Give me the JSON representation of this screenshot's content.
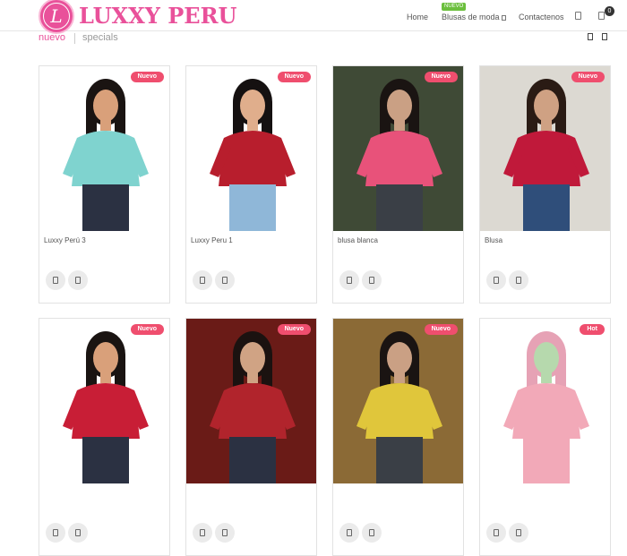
{
  "header": {
    "brand_letter": "L",
    "brand_name": "LUXXY PERU",
    "nav": {
      "home": "Home",
      "blusas": "Blusas de moda",
      "blusas_badge": "NUEVO",
      "contact": "Contactenos"
    },
    "cart_count": "0"
  },
  "tabs": {
    "active": "nuevo",
    "inactive": "specials"
  },
  "products": [
    {
      "name": "Luxxy Perú 3",
      "badge": "Nuevo",
      "bg": "#ffffff",
      "top": "#7fd3cf",
      "skin": "#d9a07a",
      "hair": "#1a1412",
      "bottom": "#2b3142"
    },
    {
      "name": "Luxxy Peru 1",
      "badge": "Nuevo",
      "bg": "#ffffff",
      "top": "#b81e2d",
      "skin": "#e0ae8c",
      "hair": "#151111",
      "bottom": "#8fb7d8"
    },
    {
      "name": "blusa blanca",
      "badge": "Nuevo",
      "bg": "#3f4a36",
      "top": "#e8527a",
      "skin": "#caa084",
      "hair": "#1a1412",
      "bottom": "#3a3f46"
    },
    {
      "name": "Blusa",
      "badge": "Nuevo",
      "bg": "#dcd9d2",
      "top": "#c0193a",
      "skin": "#cfa183",
      "hair": "#2a1b14",
      "bottom": "#2f4e7a"
    },
    {
      "name": "",
      "badge": "Nuevo",
      "bg": "#ffffff",
      "top": "#c81e36",
      "skin": "#d9a07a",
      "hair": "#1a1412",
      "bottom": "#2b3142"
    },
    {
      "name": "",
      "badge": "Nuevo",
      "bg": "#6a1b17",
      "top": "#b1242c",
      "skin": "#d0a384",
      "hair": "#1b1210",
      "bottom": "#2b3142"
    },
    {
      "name": "",
      "badge": "Nuevo",
      "bg": "#8b6a36",
      "top": "#e0c63b",
      "skin": "#caa084",
      "hair": "#1a1412",
      "bottom": "#3a3f46"
    },
    {
      "name": "",
      "badge": "Hot",
      "bg": "#ffffff",
      "top": "#f2a9b8",
      "skin": "#b6d9ad",
      "hair": "#e6a2b5",
      "bottom": "#f2a9b8"
    }
  ]
}
